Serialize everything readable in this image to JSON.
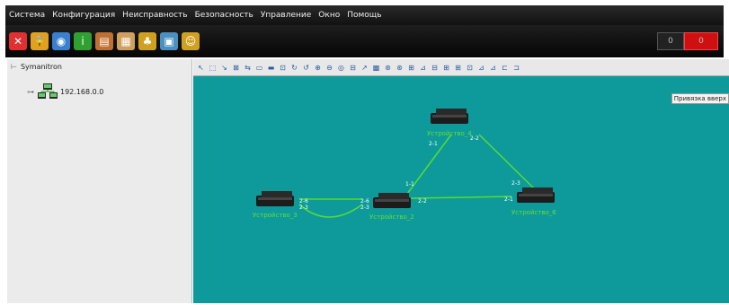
{
  "menu": [
    "Система",
    "Конфигурация",
    "Неисправность",
    "Безопасность",
    "Управление",
    "Окно",
    "Помощь"
  ],
  "toolbar": {
    "icons": [
      {
        "name": "close-icon",
        "color": "#e03030",
        "glyph": "✕"
      },
      {
        "name": "lock-icon",
        "color": "#e0a020",
        "glyph": "🔒"
      },
      {
        "name": "globe-icon",
        "color": "#3a80d0",
        "glyph": "◉"
      },
      {
        "name": "info-icon",
        "color": "#30a030",
        "glyph": "i"
      },
      {
        "name": "server-alarm-icon",
        "color": "#c07030",
        "glyph": "▤"
      },
      {
        "name": "document-icon",
        "color": "#d0a060",
        "glyph": "▦"
      },
      {
        "name": "alarm-bell-icon",
        "color": "#d0a020",
        "glyph": "♣"
      },
      {
        "name": "monitor-icon",
        "color": "#4a90c0",
        "glyph": "▣"
      },
      {
        "name": "user-icon",
        "color": "#d0a020",
        "glyph": "☺"
      }
    ],
    "window_controls": {
      "minimize": "0",
      "close": "0"
    }
  },
  "sidebar": {
    "root_label": "Symanitron",
    "node_label": "192.168.0.0"
  },
  "canvas": {
    "snap_label": "Привязка вверх",
    "devices": [
      {
        "id": "top",
        "label": "Устройство_4"
      },
      {
        "id": "left",
        "label": "Устройство_3"
      },
      {
        "id": "mid",
        "label": "Устройство_2"
      },
      {
        "id": "right",
        "label": "Устройство_6"
      }
    ],
    "port_labels": {
      "top_a": "2-1",
      "top_b": "2-2",
      "mid_top": "1-1",
      "right_top": "2-3",
      "right_left": "2-1",
      "mid_right": "2-2",
      "left_a": "2-6",
      "left_b": "2-3",
      "mid_left_a": "2-6",
      "mid_left_b": "2-3"
    }
  }
}
